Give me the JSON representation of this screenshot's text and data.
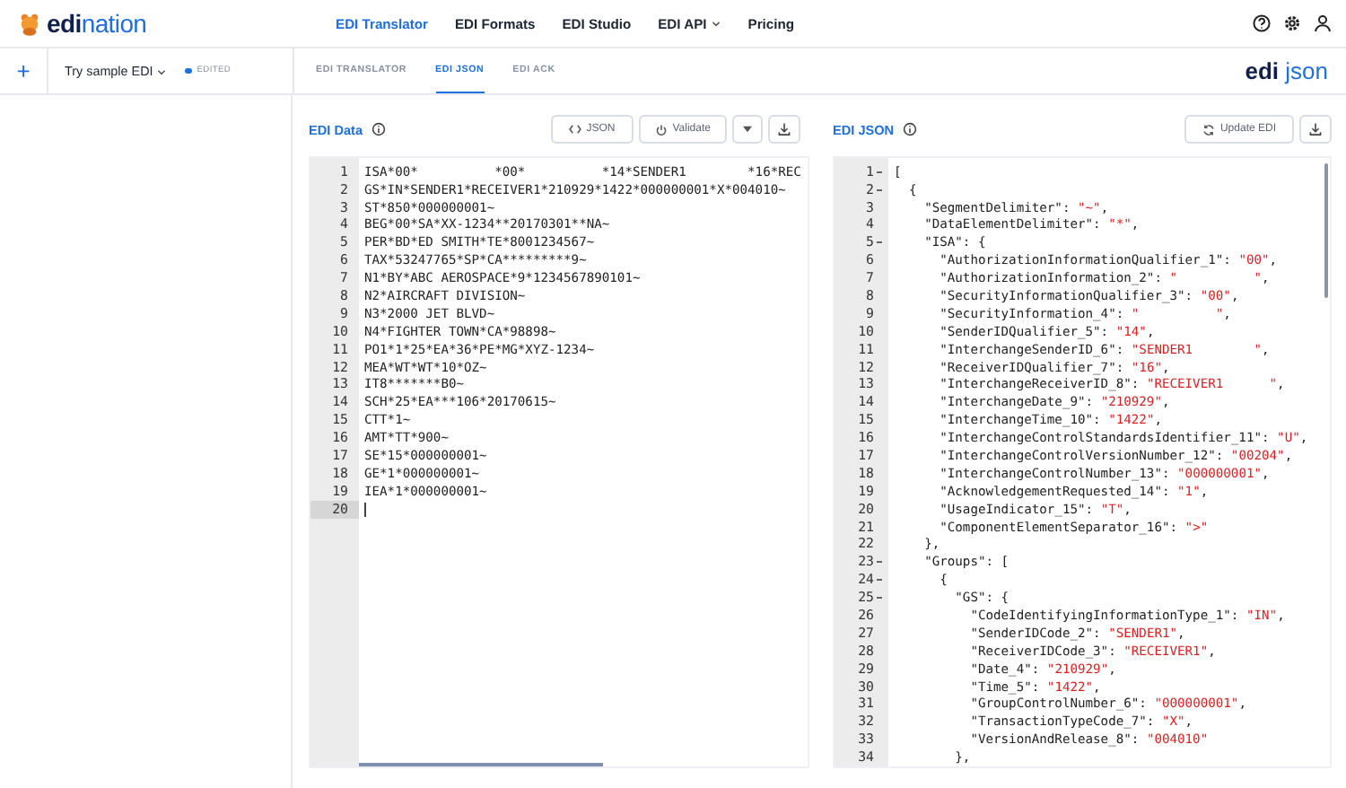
{
  "brand": {
    "name_bold": "edi",
    "name_rest": "nation"
  },
  "nav": [
    {
      "label": "EDI Translator",
      "selected": true,
      "dropdown": false
    },
    {
      "label": "EDI Formats",
      "selected": false,
      "dropdown": false
    },
    {
      "label": "EDI Studio",
      "selected": false,
      "dropdown": false
    },
    {
      "label": "EDI API",
      "selected": false,
      "dropdown": true
    },
    {
      "label": "Pricing",
      "selected": false,
      "dropdown": false
    }
  ],
  "toolbar": {
    "add": "+",
    "sample": "Try sample EDI",
    "status": "EDITED"
  },
  "tabs": [
    {
      "label": "EDI TRANSLATOR",
      "selected": false
    },
    {
      "label": "EDI JSON",
      "selected": true
    },
    {
      "label": "EDI ACK",
      "selected": false
    }
  ],
  "product_logo": {
    "bold": "edi",
    "rest": "json"
  },
  "edi_panel": {
    "title": "EDI Data",
    "buttons": [
      {
        "kind": "code",
        "label": "JSON"
      },
      {
        "kind": "power",
        "label": "Validate"
      },
      {
        "kind": "caret"
      },
      {
        "kind": "download"
      }
    ],
    "lines": [
      {
        "n": "1",
        "text": "ISA*00*          *00*          *14*SENDER1        *16*REC",
        "active": false
      },
      {
        "n": "2",
        "text": "GS*IN*SENDER1*RECEIVER1*210929*1422*000000001*X*004010~",
        "active": false
      },
      {
        "n": "3",
        "text": "ST*850*000000001~",
        "active": false
      },
      {
        "n": "4",
        "text": "BEG*00*SA*XX-1234**20170301**NA~",
        "active": false
      },
      {
        "n": "5",
        "text": "PER*BD*ED SMITH*TE*8001234567~",
        "active": false
      },
      {
        "n": "6",
        "text": "TAX*53247765*SP*CA*********9~",
        "active": false
      },
      {
        "n": "7",
        "text": "N1*BY*ABC AEROSPACE*9*1234567890101~",
        "active": false
      },
      {
        "n": "8",
        "text": "N2*AIRCRAFT DIVISION~",
        "active": false
      },
      {
        "n": "9",
        "text": "N3*2000 JET BLVD~",
        "active": false
      },
      {
        "n": "10",
        "text": "N4*FIGHTER TOWN*CA*98898~",
        "active": false
      },
      {
        "n": "11",
        "text": "PO1*1*25*EA*36*PE*MG*XYZ-1234~",
        "active": false
      },
      {
        "n": "12",
        "text": "MEA*WT*WT*10*OZ~",
        "active": false
      },
      {
        "n": "13",
        "text": "IT8*******B0~",
        "active": false
      },
      {
        "n": "14",
        "text": "SCH*25*EA***106*20170615~",
        "active": false
      },
      {
        "n": "15",
        "text": "CTT*1~",
        "active": false
      },
      {
        "n": "16",
        "text": "AMT*TT*900~",
        "active": false
      },
      {
        "n": "17",
        "text": "SE*15*000000001~",
        "active": false
      },
      {
        "n": "18",
        "text": "GE*1*000000001~",
        "active": false
      },
      {
        "n": "19",
        "text": "IEA*1*000000001~",
        "active": false
      },
      {
        "n": "20",
        "active": true
      }
    ]
  },
  "json_panel": {
    "title": "EDI JSON",
    "buttons": [
      {
        "kind": "refresh",
        "label": "Update EDI"
      },
      {
        "kind": "download"
      }
    ],
    "lines": [
      {
        "n": "1",
        "fold": true,
        "pre": "["
      },
      {
        "n": "2",
        "fold": true,
        "pre": "  {"
      },
      {
        "n": "3",
        "fold": false,
        "pre": "    \"SegmentDelimiter\": ",
        "value": "\"~\"",
        "post": ","
      },
      {
        "n": "4",
        "fold": false,
        "pre": "    \"DataElementDelimiter\": ",
        "value": "\"*\"",
        "post": ","
      },
      {
        "n": "5",
        "fold": true,
        "pre": "    \"ISA\": {"
      },
      {
        "n": "6",
        "fold": false,
        "pre": "      \"AuthorizationInformationQualifier_1\": ",
        "value": "\"00\"",
        "post": ","
      },
      {
        "n": "7",
        "fold": false,
        "pre": "      \"AuthorizationInformation_2\": ",
        "value": "\"          \"",
        "post": ","
      },
      {
        "n": "8",
        "fold": false,
        "pre": "      \"SecurityInformationQualifier_3\": ",
        "value": "\"00\"",
        "post": ","
      },
      {
        "n": "9",
        "fold": false,
        "pre": "      \"SecurityInformation_4\": ",
        "value": "\"          \"",
        "post": ","
      },
      {
        "n": "10",
        "fold": false,
        "pre": "      \"SenderIDQualifier_5\": ",
        "value": "\"14\"",
        "post": ","
      },
      {
        "n": "11",
        "fold": false,
        "pre": "      \"InterchangeSenderID_6\": ",
        "value": "\"SENDER1        \"",
        "post": ","
      },
      {
        "n": "12",
        "fold": false,
        "pre": "      \"ReceiverIDQualifier_7\": ",
        "value": "\"16\"",
        "post": ","
      },
      {
        "n": "13",
        "fold": false,
        "pre": "      \"InterchangeReceiverID_8\": ",
        "value": "\"RECEIVER1      \"",
        "post": ","
      },
      {
        "n": "14",
        "fold": false,
        "pre": "      \"InterchangeDate_9\": ",
        "value": "\"210929\"",
        "post": ","
      },
      {
        "n": "15",
        "fold": false,
        "pre": "      \"InterchangeTime_10\": ",
        "value": "\"1422\"",
        "post": ","
      },
      {
        "n": "16",
        "fold": false,
        "pre": "      \"InterchangeControlStandardsIdentifier_11\": ",
        "value": "\"U\"",
        "post": ","
      },
      {
        "n": "17",
        "fold": false,
        "pre": "      \"InterchangeControlVersionNumber_12\": ",
        "value": "\"00204\"",
        "post": ","
      },
      {
        "n": "18",
        "fold": false,
        "pre": "      \"InterchangeControlNumber_13\": ",
        "value": "\"000000001\"",
        "post": ","
      },
      {
        "n": "19",
        "fold": false,
        "pre": "      \"AcknowledgementRequested_14\": ",
        "value": "\"1\"",
        "post": ","
      },
      {
        "n": "20",
        "fold": false,
        "pre": "      \"UsageIndicator_15\": ",
        "value": "\"T\"",
        "post": ","
      },
      {
        "n": "21",
        "fold": false,
        "pre": "      \"ComponentElementSeparator_16\": ",
        "value": "\">\""
      },
      {
        "n": "22",
        "fold": false,
        "pre": "    },"
      },
      {
        "n": "23",
        "fold": true,
        "pre": "    \"Groups\": ["
      },
      {
        "n": "24",
        "fold": true,
        "pre": "      {"
      },
      {
        "n": "25",
        "fold": true,
        "pre": "        \"GS\": {"
      },
      {
        "n": "26",
        "fold": false,
        "pre": "          \"CodeIdentifyingInformationType_1\": ",
        "value": "\"IN\"",
        "post": ","
      },
      {
        "n": "27",
        "fold": false,
        "pre": "          \"SenderIDCode_2\": ",
        "value": "\"SENDER1\"",
        "post": ","
      },
      {
        "n": "28",
        "fold": false,
        "pre": "          \"ReceiverIDCode_3\": ",
        "value": "\"RECEIVER1\"",
        "post": ","
      },
      {
        "n": "29",
        "fold": false,
        "pre": "          \"Date_4\": ",
        "value": "\"210929\"",
        "post": ","
      },
      {
        "n": "30",
        "fold": false,
        "pre": "          \"Time_5\": ",
        "value": "\"1422\"",
        "post": ","
      },
      {
        "n": "31",
        "fold": false,
        "pre": "          \"GroupControlNumber_6\": ",
        "value": "\"000000001\"",
        "post": ","
      },
      {
        "n": "32",
        "fold": false,
        "pre": "          \"TransactionTypeCode_7\": ",
        "value": "\"X\"",
        "post": ","
      },
      {
        "n": "33",
        "fold": false,
        "pre": "          \"VersionAndRelease_8\": ",
        "value": "\"004010\""
      },
      {
        "n": "34",
        "fold": false,
        "pre": "        },"
      }
    ]
  }
}
